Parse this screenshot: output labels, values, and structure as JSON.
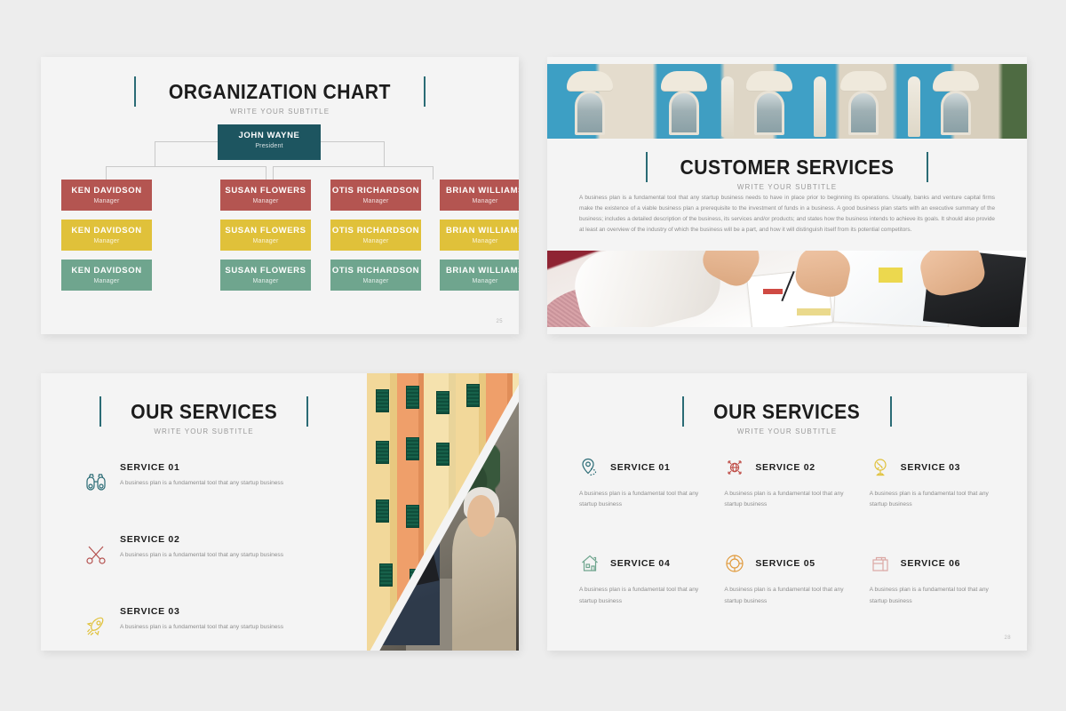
{
  "theme": {
    "canvas_bg": "#ededed",
    "slide_bg": "#f4f4f4",
    "accent_teal": "#2a6b75",
    "node_president": "#1d5560",
    "node_red": "#b45551",
    "node_yellow": "#e0c13a",
    "node_green": "#6fa58e",
    "heading": "#1c1c1c",
    "muted": "#8d8d8d"
  },
  "slides": {
    "org_chart": {
      "title": "ORGANIZATION CHART",
      "subtitle": "WRITE YOUR SUBTITLE",
      "page_number": "25",
      "president": {
        "name": "JOHN WAYNE",
        "role": "President"
      },
      "columns": [
        "KEN DAVIDSON",
        "SUSAN FLOWERS",
        "OTIS RICHARDSON",
        "BRIAN WILLIAMS"
      ],
      "rows": [
        {
          "color_key": "node_red",
          "role": "Manager",
          "names": [
            "KEN DAVIDSON",
            "SUSAN FLOWERS",
            "OTIS RICHARDSON",
            "BRIAN WILLIAMS"
          ]
        },
        {
          "color_key": "node_yellow",
          "role": "Manager",
          "names": [
            "KEN DAVIDSON",
            "SUSAN FLOWERS",
            "OTIS RICHARDSON",
            "BRIAN WILLIAMS"
          ]
        },
        {
          "color_key": "node_green",
          "role": "Manager",
          "names": [
            "KEN DAVIDSON",
            "SUSAN FLOWERS",
            "OTIS RICHARDSON",
            "BRIAN WILLIAMS"
          ]
        }
      ]
    },
    "customer_services": {
      "title": "CUSTOMER SERVICES",
      "subtitle": "WRITE YOUR SUBTITLE",
      "body": "A business plan is a fundamental tool that any startup business needs to have in place prior to beginning its operations. Usually, banks and venture capital firms make the existence of a viable business plan a prerequisite to the investment of funds in a business. A good business plan starts with an executive summary of the business; includes a detailed description of the business, its services and/or products; and states how the business intends to achieve its goals. It should also provide at least an overview of the industry of which the business will be a part, and how it will distinguish itself from its potential competitors.",
      "photo_top_alt": "ornate-building-facade-photo",
      "photo_bottom_alt": "business-meeting-table-photo"
    },
    "our_services_3": {
      "title": "OUR SERVICES",
      "subtitle": "WRITE YOUR SUBTITLE",
      "photo_alt": "italian-facade-and-consultation-photo",
      "items": [
        {
          "icon": "binoculars-icon",
          "color": "#2a6b75",
          "label": "SERVICE 01",
          "text": "A business plan is a fundamental tool that any startup business"
        },
        {
          "icon": "scissors-icon",
          "color": "#b4514f",
          "label": "SERVICE 02",
          "text": "A business plan is a fundamental tool that any startup business"
        },
        {
          "icon": "rocket-icon",
          "color": "#e0c13a",
          "label": "SERVICE 03",
          "text": "A business plan is a fundamental tool that any startup business"
        }
      ]
    },
    "our_services_6": {
      "title": "OUR SERVICES",
      "subtitle": "WRITE YOUR SUBTITLE",
      "page_number": "28",
      "items": [
        {
          "icon": "location-pin-icon",
          "color": "#2a6b75",
          "label": "SERVICE 01",
          "text": "A business plan is a fundamental tool that any startup business"
        },
        {
          "icon": "globe-arrows-icon",
          "color": "#c0504a",
          "label": "SERVICE 02",
          "text": "A business plan is a fundamental tool that any startup business"
        },
        {
          "icon": "globe-stand-icon",
          "color": "#e0c13a",
          "label": "SERVICE 03",
          "text": "A business plan is a fundamental tool that any startup business"
        },
        {
          "icon": "house-icon",
          "color": "#6fa58e",
          "label": "SERVICE 04",
          "text": "A business plan is a fundamental tool that any startup business"
        },
        {
          "icon": "lifebuoy-icon",
          "color": "#e09a3c",
          "label": "SERVICE 05",
          "text": "A business plan is a fundamental tool that any startup business"
        },
        {
          "icon": "briefcase-icon",
          "color": "#dba8a4",
          "label": "SERVICE 06",
          "text": "A business plan is a fundamental tool that any startup business"
        }
      ]
    }
  }
}
